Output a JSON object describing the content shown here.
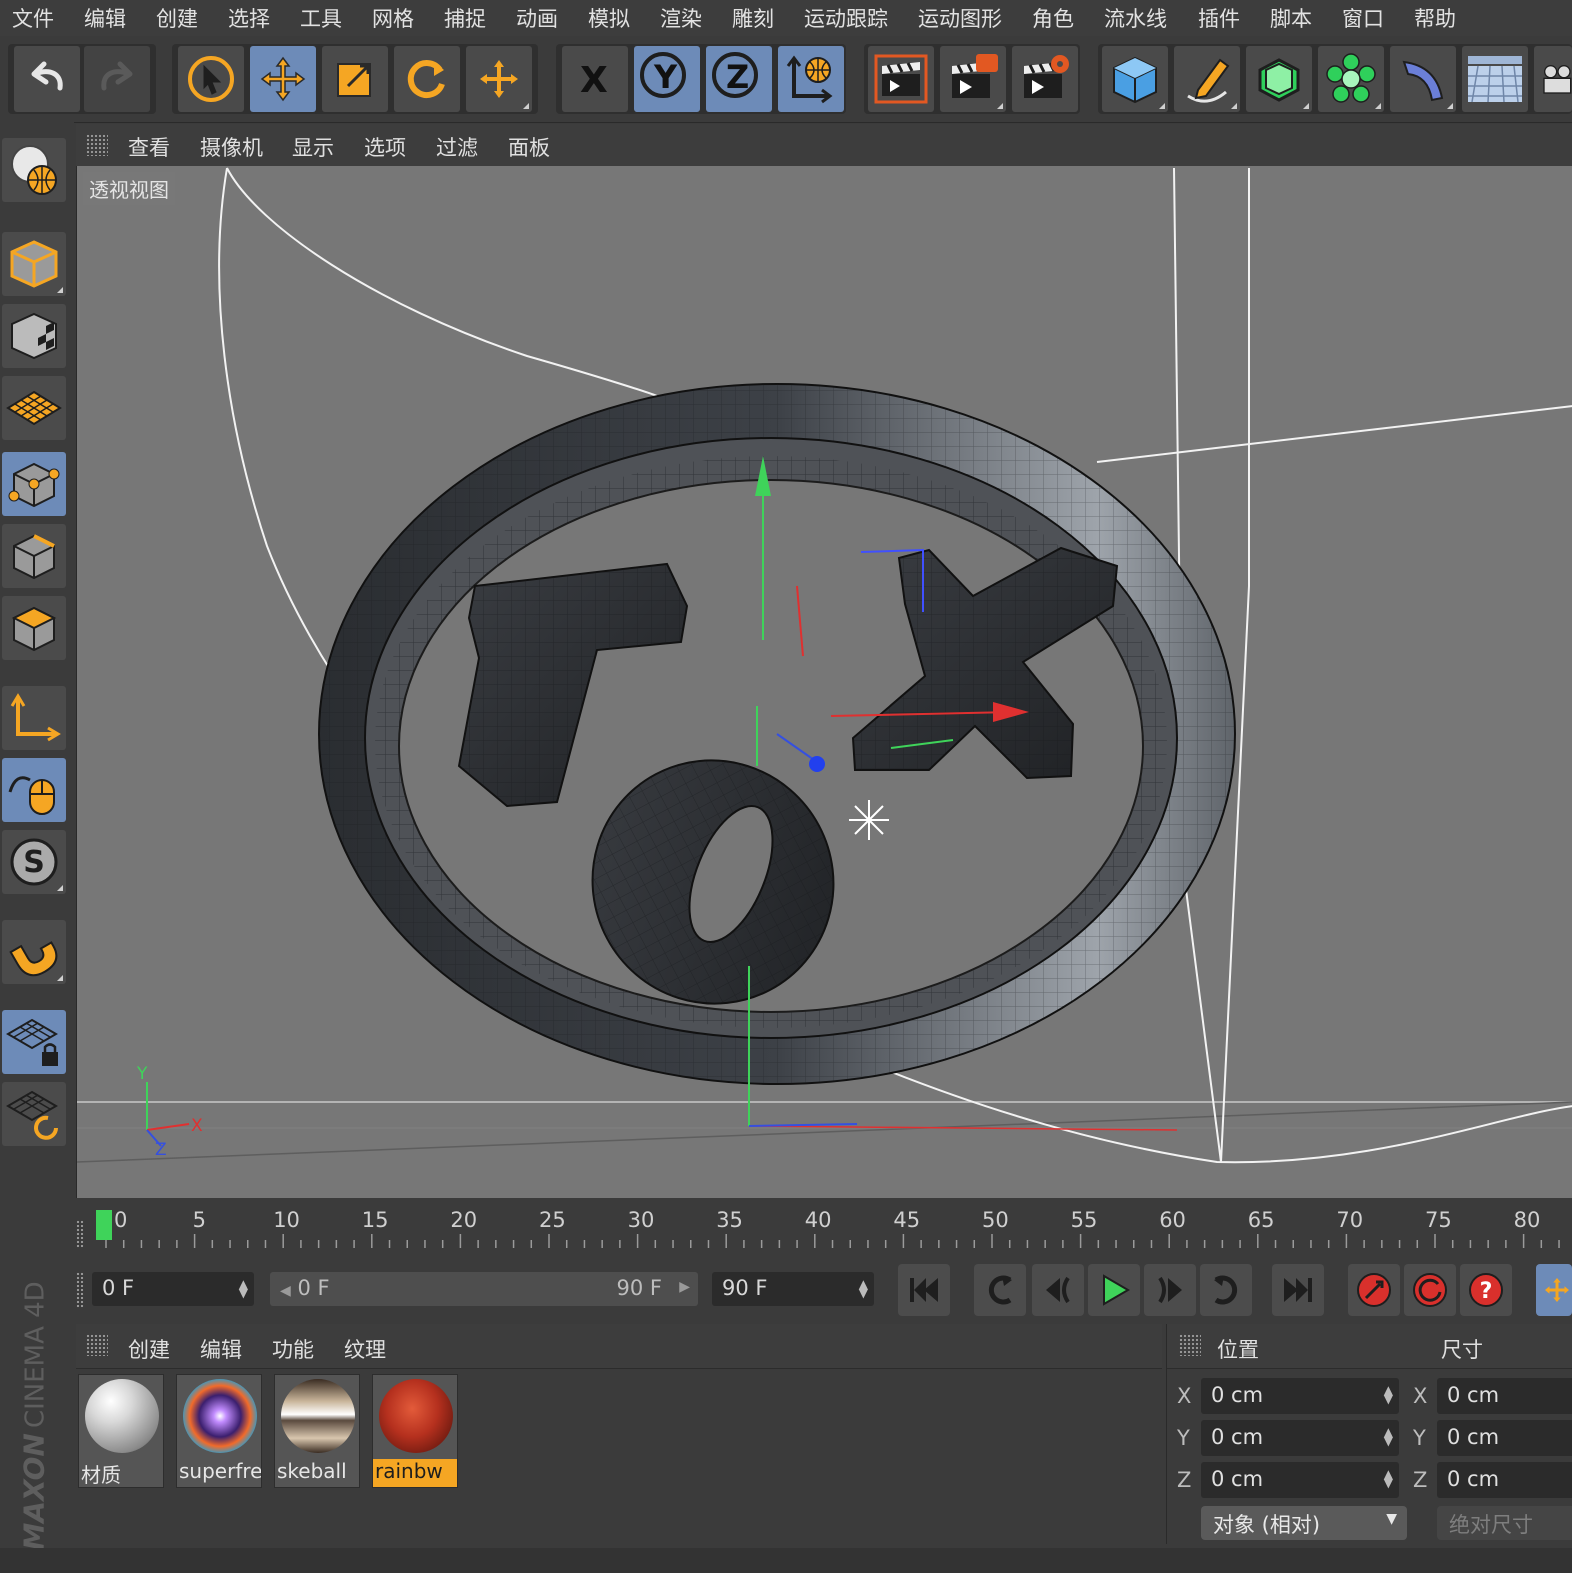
{
  "menu": {
    "items": [
      "文件",
      "编辑",
      "创建",
      "选择",
      "工具",
      "网格",
      "捕捉",
      "动画",
      "模拟",
      "渲染",
      "雕刻",
      "运动跟踪",
      "运动图形",
      "角色",
      "流水线",
      "插件",
      "脚本",
      "窗口",
      "帮助"
    ]
  },
  "toolbar": {
    "axis_x": "X",
    "axis_y": "Y",
    "axis_z": "Z"
  },
  "viewport_menu": {
    "items": [
      "查看",
      "摄像机",
      "显示",
      "选项",
      "过滤",
      "面板"
    ]
  },
  "viewport": {
    "label": "透视视图",
    "axis_y": "Y",
    "axis_x": "X",
    "axis_z": "Z"
  },
  "timeline": {
    "ticks": [
      "0",
      "5",
      "10",
      "15",
      "20",
      "25",
      "30",
      "35",
      "40",
      "45",
      "50",
      "55",
      "60",
      "65",
      "70",
      "75",
      "80"
    ],
    "current_frame_fraction": 0
  },
  "transport": {
    "current_frame": "0 F",
    "range_start": "0 F",
    "range_end": "90 F",
    "end_frame": "90 F"
  },
  "material_manager": {
    "menu": [
      "创建",
      "编辑",
      "功能",
      "纹理"
    ],
    "materials": [
      {
        "name": "材质",
        "selected": false
      },
      {
        "name": "superfre",
        "selected": false
      },
      {
        "name": "skeball",
        "selected": false
      },
      {
        "name": "rainbw",
        "selected": true
      }
    ]
  },
  "attributes": {
    "position_header": "位置",
    "size_header": "尺寸",
    "rows": [
      {
        "axis": "X",
        "position": "0 cm",
        "size": "0 cm"
      },
      {
        "axis": "Y",
        "position": "0 cm",
        "size": "0 cm"
      },
      {
        "axis": "Z",
        "position": "0 cm",
        "size": "0 cm"
      }
    ],
    "coord_mode": "对象 (相对)",
    "size_mode": "绝对尺寸"
  },
  "branding": {
    "logo_text_1": "MAXON",
    "logo_text_2": "CINEMA 4D"
  },
  "colors": {
    "accent_blue": "#6d8bb8",
    "orange": "#f5a623",
    "viewport_bg": "#777777",
    "play_green": "#3fd35a",
    "record_red": "#d9302c"
  }
}
